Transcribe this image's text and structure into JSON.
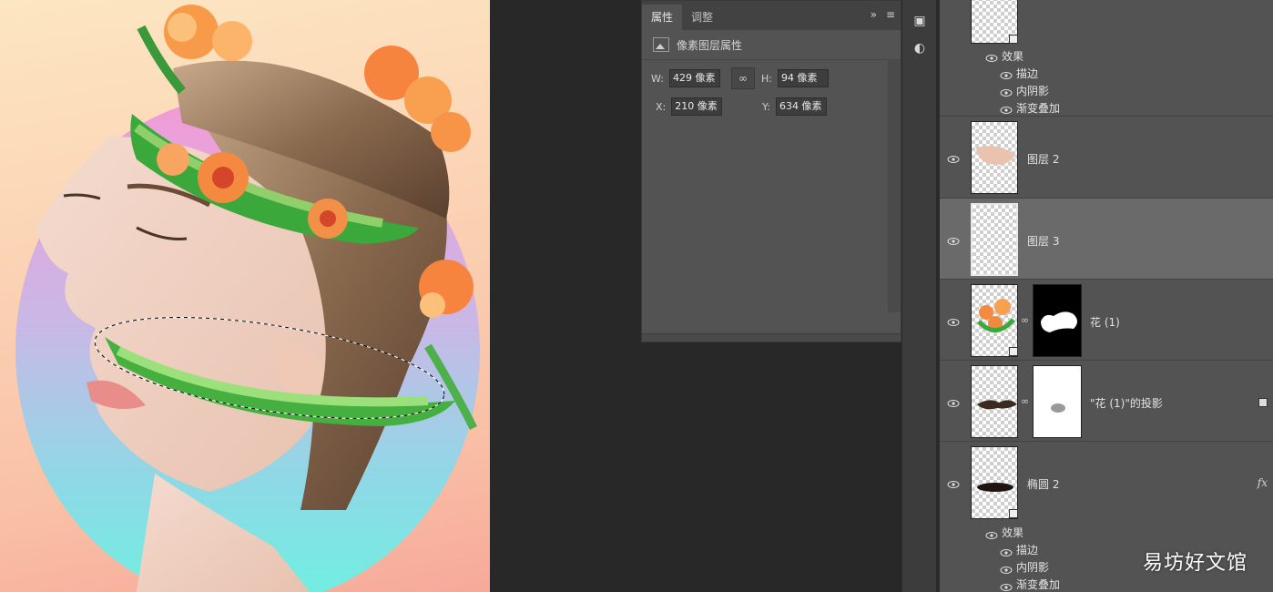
{
  "properties_panel": {
    "tabs": [
      "属性",
      "调整"
    ],
    "title": "像素图层属性",
    "w_label": "W:",
    "w_value": "429 像素",
    "h_label": "H:",
    "h_value": "94 像素",
    "x_label": "X:",
    "x_value": "210 像素",
    "y_label": "Y:",
    "y_value": "634 像素"
  },
  "layers": [
    {
      "name": "",
      "type": "shape",
      "effects_label": "效果",
      "effects": [
        "描边",
        "内阴影",
        "渐变叠加"
      ]
    },
    {
      "name": "图层 2",
      "type": "pixel"
    },
    {
      "name": "图层 3",
      "type": "pixel",
      "selected": true
    },
    {
      "name": "花 (1)",
      "type": "smart-object-with-mask"
    },
    {
      "name": "\"花 (1)\"的投影",
      "type": "pixel-with-mask"
    },
    {
      "name": "椭圆 2",
      "type": "shape",
      "fx": "fx",
      "effects_label": "效果",
      "effects": [
        "描边",
        "内阴影",
        "渐变叠加"
      ]
    }
  ],
  "watermark": "易坊好文馆",
  "colors": {
    "panel": "#535353",
    "dark": "#282828",
    "selected_layer": "#6a6a6a"
  }
}
